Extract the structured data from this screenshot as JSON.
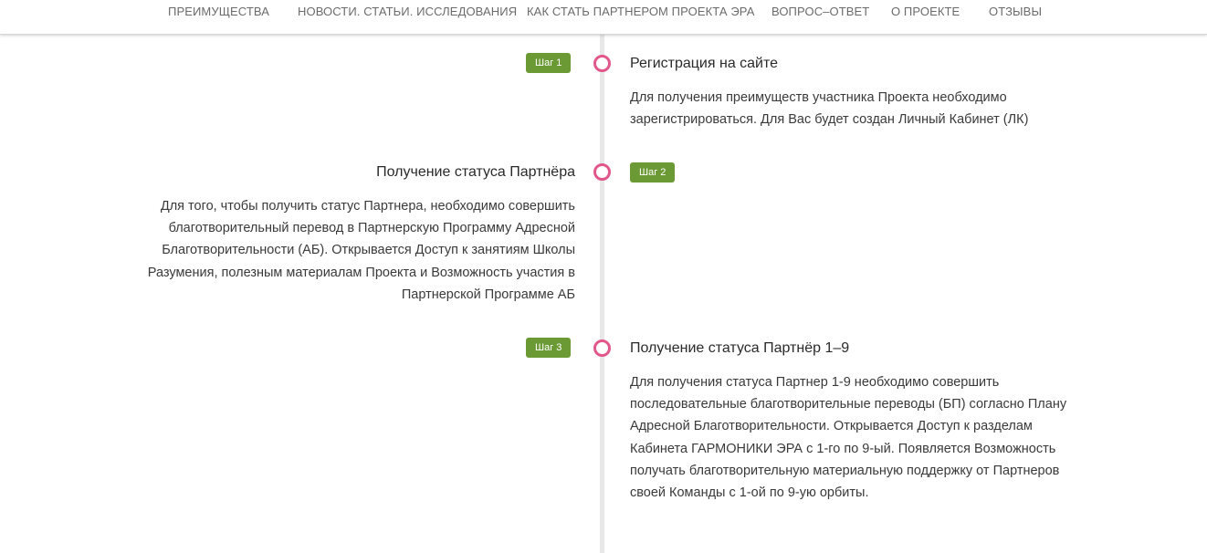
{
  "nav": {
    "items": [
      "ПРЕИМУЩЕСТВА",
      "НОВОСТИ. СТАТЬИ. ИССЛЕДОВАНИЯ",
      "КАК СТАТЬ ПАРТНЕРОМ ПРОЕКТА ЭРА",
      "ВОПРОС–ОТВЕТ",
      "О ПРОЕКТЕ",
      "ОТЗЫВЫ"
    ]
  },
  "colors": {
    "accent_dot": "#e2578a",
    "badge_green": "#6b9a35",
    "timeline_line": "#e8e8e8"
  },
  "steps": [
    {
      "badge": "Шаг 1",
      "title": "Регистрация на сайте",
      "text": [
        "Для получения преимуществ участника Проекта необходимо",
        "зарегистрироваться. Для Вас будет создан Личный Кабинет (ЛК)"
      ]
    },
    {
      "badge": "Шаг 2",
      "title": "Получение статуса Партнёра",
      "text": [
        "Для того, чтобы получить статус Партнера, необходимо совершить",
        "благотворительный перевод в Партнерскую Программу Адресной",
        "Благотворительности (АБ). Открывается Доступ к занятиям Школы",
        "Разумения, полезным материалам Проекта и Возможность участия в",
        "Партнерской Программе АБ"
      ]
    },
    {
      "badge": "Шаг 3",
      "title": "Получение статуса Партнёр 1–9",
      "text": [
        "Для получения статуса Партнер 1-9 необходимо совершить",
        "последовательные благотворительные переводы (БП) согласно Плану",
        "Адресной Благотворительности. Открывается Доступ к разделам",
        "Кабинета ГАРМОНИКИ ЭРА  с 1-го по 9-ый. Появляется Возможность",
        "получать благотворительную материальную поддержку от Партнеров",
        "своей Команды с 1-ой по 9-ую орбиты."
      ]
    }
  ]
}
